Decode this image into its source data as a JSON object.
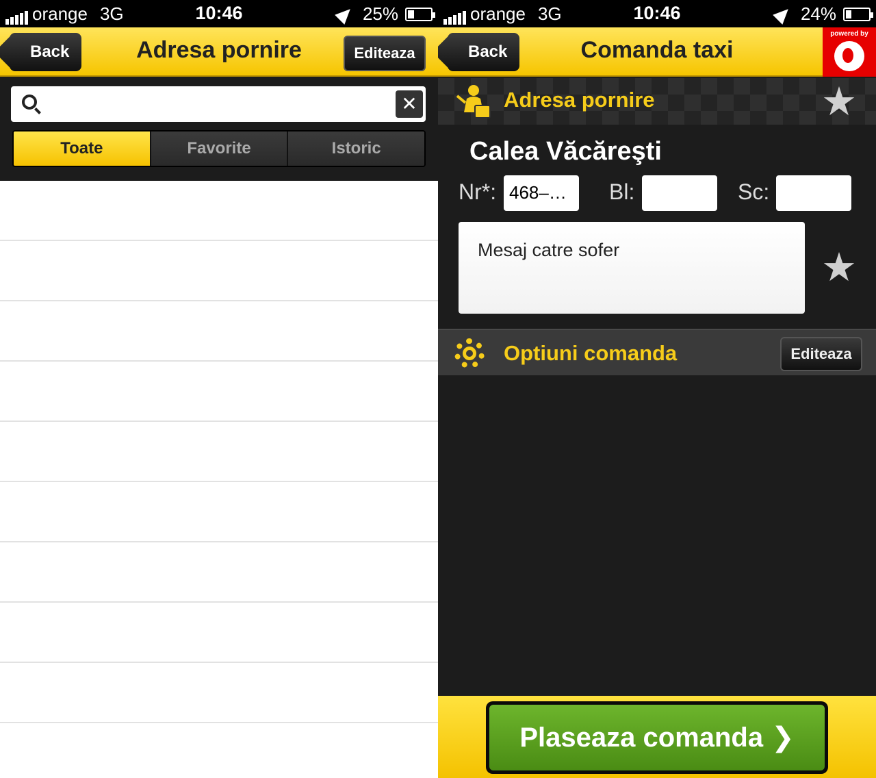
{
  "left": {
    "status": {
      "carrier": "orange",
      "network": "3G",
      "time": "10:46",
      "battery": "25%",
      "battery_level": 0.25
    },
    "nav": {
      "back_label": "Back",
      "title": "Adresa pornire",
      "edit_label": "Editeaza"
    },
    "search": {
      "placeholder": "",
      "value": ""
    },
    "segments": [
      {
        "label": "Toate",
        "active": true
      },
      {
        "label": "Favorite",
        "active": false
      },
      {
        "label": "Istoric",
        "active": false
      }
    ],
    "list_rows": 10
  },
  "right": {
    "status": {
      "carrier": "orange",
      "network": "3G",
      "time": "10:46",
      "battery": "24%",
      "battery_level": 0.24
    },
    "nav": {
      "back_label": "Back",
      "title": "Comanda taxi",
      "powered_by": "powered by"
    },
    "pickup": {
      "section_title": "Adresa pornire",
      "street": "Calea Văcăreşti",
      "nr_label": "Nr*:",
      "nr_value": "468–…",
      "bl_label": "Bl:",
      "bl_value": "",
      "sc_label": "Sc:",
      "sc_value": "",
      "message_placeholder": "Mesaj catre sofer"
    },
    "options": {
      "title": "Optiuni comanda",
      "edit_label": "Editeaza"
    },
    "order_button": "Plaseaza comanda"
  },
  "colors": {
    "accent_yellow": "#f6c500",
    "order_green": "#5ea11f",
    "vodafone_red": "#e60000"
  }
}
